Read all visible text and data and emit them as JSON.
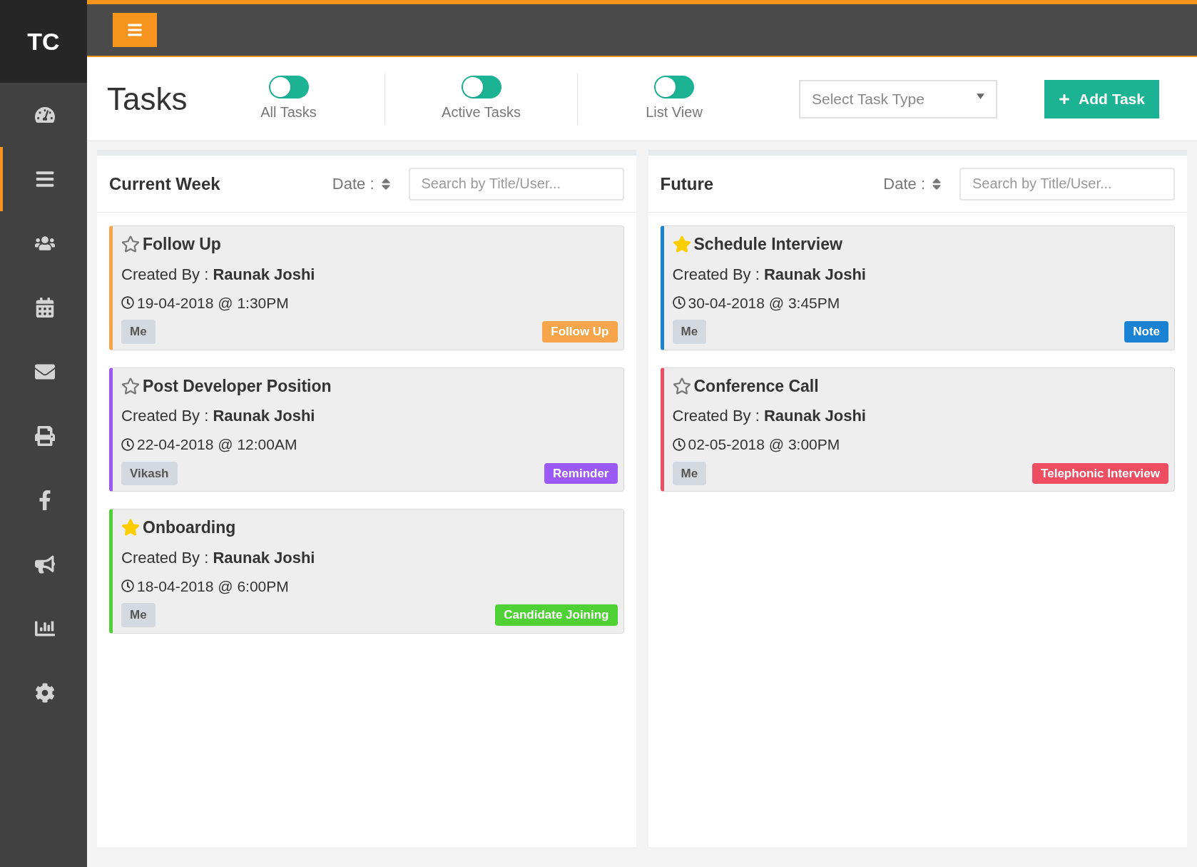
{
  "logo": "TC",
  "sidebar": {
    "items": [
      {
        "selected": false
      },
      {
        "selected": true
      },
      {
        "selected": false
      },
      {
        "selected": false
      },
      {
        "selected": false
      },
      {
        "selected": false
      },
      {
        "selected": false
      },
      {
        "selected": false
      },
      {
        "selected": false
      },
      {
        "selected": false
      }
    ]
  },
  "page_title": "Tasks",
  "toggles": [
    {
      "label": "All Tasks",
      "on": false
    },
    {
      "label": "Active Tasks",
      "on": false
    },
    {
      "label": "List View",
      "on": false
    }
  ],
  "task_type_select": {
    "placeholder": "Select Task Type"
  },
  "add_button": "Add Task",
  "columns": [
    {
      "title": "Current Week",
      "sort_label": "Date :",
      "search": {
        "placeholder": "Search by Title/User..."
      },
      "tasks": [
        {
          "title": "Follow Up",
          "starred": false,
          "created_by": "Created By : **Raunak Joshi**",
          "datetime": "19-04-2018 @ 1:30PM",
          "assignee": "Me",
          "tag": "Follow Up",
          "color": "#f7a54a"
        },
        {
          "title": "Post Developer Position",
          "starred": false,
          "created_by": "Created By : **Raunak Joshi**",
          "datetime": "22-04-2018 @ 12:00AM",
          "assignee": "Vikash",
          "tag": "Reminder",
          "color": "#9b59f6"
        },
        {
          "title": "Onboarding",
          "starred": true,
          "created_by": "Created By : **Raunak Joshi**",
          "datetime": "18-04-2018 @ 6:00PM",
          "assignee": "Me",
          "tag": "Candidate Joining",
          "color": "#4fd135"
        }
      ]
    },
    {
      "title": "Future",
      "sort_label": "Date :",
      "search": {
        "placeholder": "Search by Title/User..."
      },
      "tasks": [
        {
          "title": "Schedule Interview",
          "starred": true,
          "created_by": "Created By : **Raunak Joshi**",
          "datetime": "30-04-2018 @ 3:45PM",
          "assignee": "Me",
          "tag": "Note",
          "color": "#1a82d2"
        },
        {
          "title": "Conference Call",
          "starred": false,
          "created_by": "Created By : **Raunak Joshi**",
          "datetime": "02-05-2018 @ 3:00PM",
          "assignee": "Me",
          "tag": "Telephonic Interview",
          "color": "#ef4e62"
        }
      ]
    }
  ]
}
